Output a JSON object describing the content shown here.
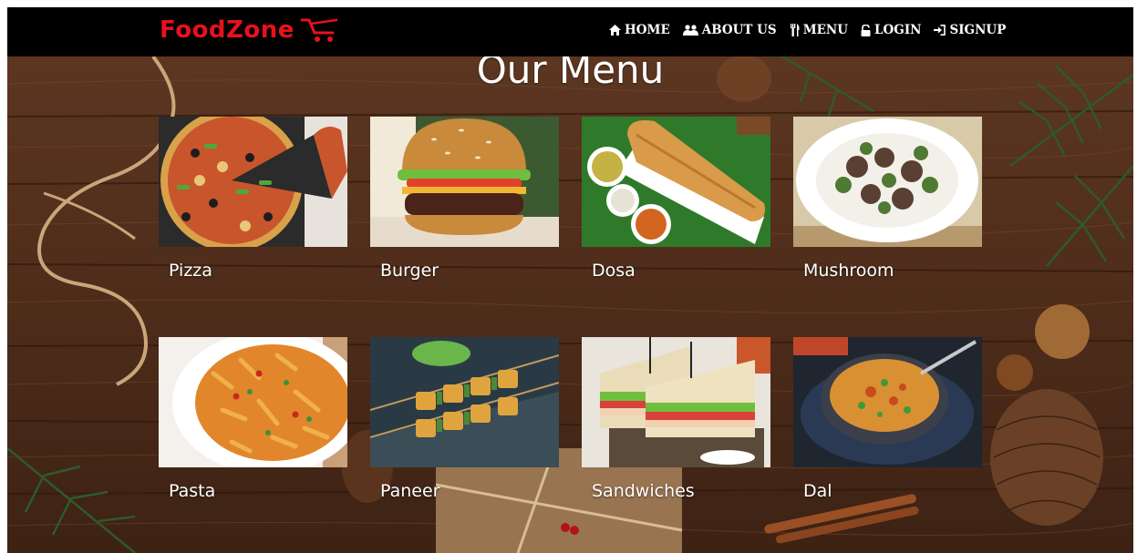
{
  "brand": {
    "name": "FoodZone"
  },
  "nav": [
    {
      "label": "HOME",
      "icon": "home-icon"
    },
    {
      "label": "ABOUT US",
      "icon": "users-icon"
    },
    {
      "label": "MENU",
      "icon": "cutlery-icon"
    },
    {
      "label": "LOGIN",
      "icon": "unlock-icon"
    },
    {
      "label": "SIGNUP",
      "icon": "sign-in-icon"
    }
  ],
  "page": {
    "title": "Our Menu"
  },
  "menu": [
    {
      "label": "Pizza"
    },
    {
      "label": "Burger"
    },
    {
      "label": "Dosa"
    },
    {
      "label": "Mushroom"
    },
    {
      "label": "Pasta"
    },
    {
      "label": "Paneer"
    },
    {
      "label": "Sandwiches"
    },
    {
      "label": "Dal"
    }
  ],
  "colors": {
    "brand": "#e8111c",
    "navbar": "#000000",
    "wood": "#5a3520"
  }
}
